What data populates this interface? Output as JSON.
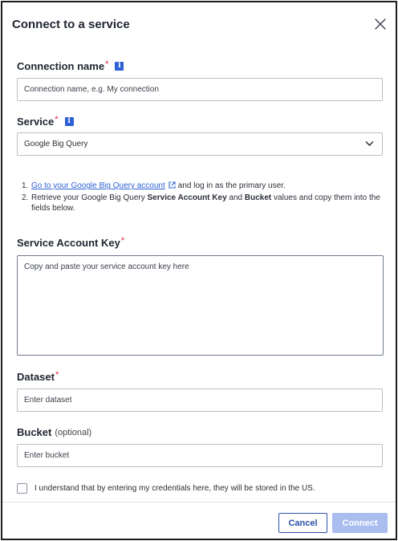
{
  "dialog": {
    "title": "Connect to a service",
    "close_icon": "close-icon"
  },
  "connection_name": {
    "label": "Connection name",
    "required_mark": "*",
    "info_icon": "info-icon",
    "placeholder": "Connection name, e.g. My connection",
    "value": ""
  },
  "service": {
    "label": "Service",
    "required_mark": "*",
    "info_icon": "info-icon",
    "selected": "Google Big Query",
    "chevron_icon": "chevron-down-icon"
  },
  "instructions": {
    "step1_num": "1.",
    "step1_link": "Go to your Google Big Query account",
    "step1_rest": "and log in as the primary user.",
    "step2_num": "2.",
    "step2_prefix": "Retrieve your Google Big Query",
    "step2_bold1": "Service Account Key",
    "step2_and": "and",
    "step2_bold2": "Bucket",
    "step2_suffix": "values and copy them into the fields below.",
    "external_link_icon": "external-link-icon"
  },
  "service_account_key": {
    "label": "Service Account Key",
    "required_mark": "*",
    "placeholder": "Copy and paste your service account key here",
    "value": ""
  },
  "dataset": {
    "label": "Dataset",
    "required_mark": "*",
    "placeholder": "Enter dataset",
    "value": ""
  },
  "bucket": {
    "label": "Bucket",
    "optional_text": "(optional)",
    "placeholder": "Enter bucket",
    "value": ""
  },
  "consent": {
    "text": "I understand that by entering my credentials here, they will be stored in the US.",
    "checked": false
  },
  "footer": {
    "cancel_label": "Cancel",
    "connect_label": "Connect"
  },
  "colors": {
    "primary": "#2a4fa8",
    "link": "#2d61d6",
    "required": "#d9263f",
    "connect_disabled": "#a9bdef"
  }
}
